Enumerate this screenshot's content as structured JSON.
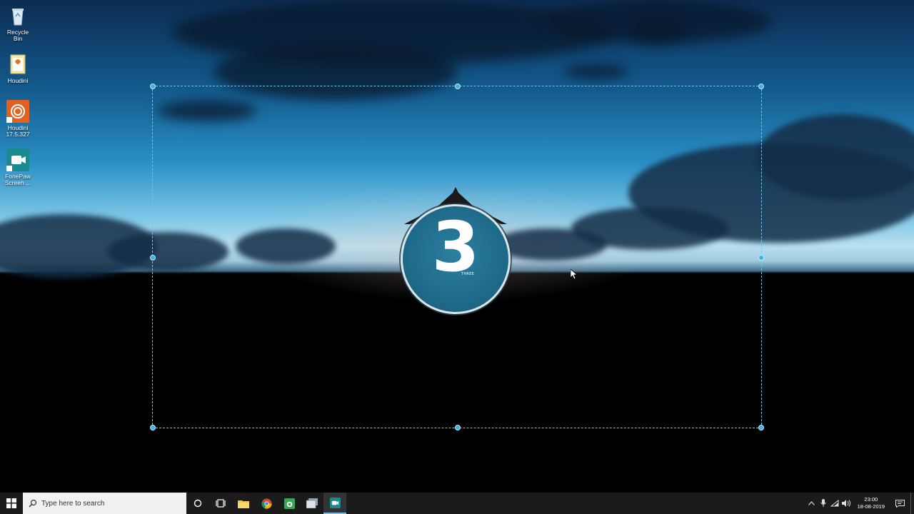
{
  "desktop_icons": [
    {
      "label": "Recycle Bin"
    },
    {
      "label": "Houdini"
    },
    {
      "label": "Houdini 17.5.327"
    },
    {
      "label": "FonePaw Screen ..."
    }
  ],
  "countdown": {
    "digit": "3",
    "word": "THREE"
  },
  "taskbar": {
    "search_placeholder": "Type here to search",
    "clock_time": "23:00",
    "clock_date": "18-08-2019"
  },
  "colors": {
    "selection": "#6ec6e8",
    "countdown_fill": "#1f6a8a",
    "taskbar": "#1b1b1b"
  }
}
